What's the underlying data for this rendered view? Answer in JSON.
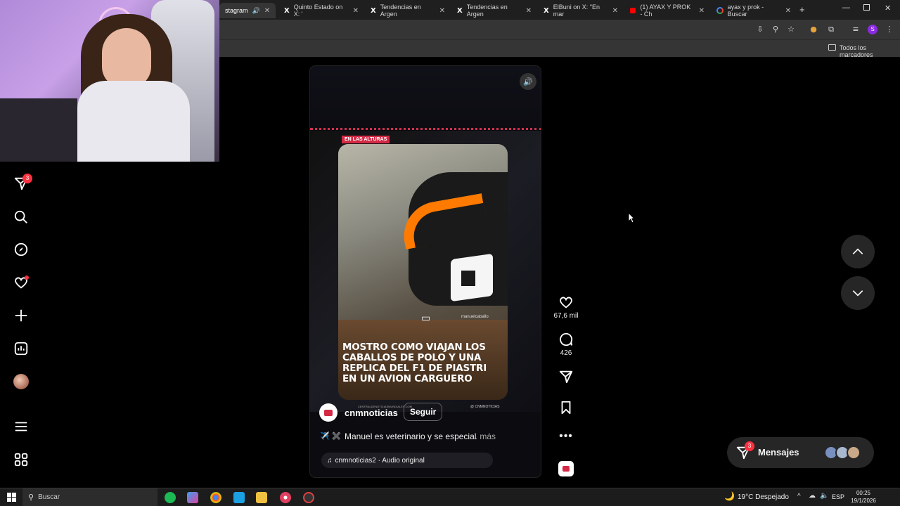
{
  "browser": {
    "tabs": [
      {
        "label": "stagram",
        "favicon": "instagram",
        "active": true
      },
      {
        "label": "Quinto Estado on X: '",
        "favicon": "x"
      },
      {
        "label": "Tendencias en Argen",
        "favicon": "x"
      },
      {
        "label": "Tendencias en Argen",
        "favicon": "x"
      },
      {
        "label": "ElBuni on X: \"En mar",
        "favicon": "x"
      },
      {
        "label": "(1) AYAX Y PROK - Ch",
        "favicon": "youtube"
      },
      {
        "label": "ayax y prok - Buscar",
        "favicon": "google"
      }
    ],
    "bookmarks_label": "Todos los marcadores",
    "profile_initial": "S"
  },
  "sidebar": {
    "notifications_badge": "3"
  },
  "reel": {
    "banner": "EN LAS ALTURAS",
    "caption_overlay": [
      "MOSTRO COMO VIAJAN LOS",
      "CABALLOS DE POLO Y UNA",
      "REPLICA DEL F1 DE PIASTRI",
      "EN UN AVION CARGUERO"
    ],
    "watermark": "manuelcaballo",
    "credit_right": "@ CNMNOTICIAS",
    "credit_left": "CENTRALDENOTICIASMUNDIALES.COM",
    "username": "cnmnoticias",
    "follow_label": "Seguir",
    "caption_emojis": "✈️ ✖️",
    "caption": "Manuel es veterinario y se especial",
    "more_label": "... más",
    "audio": "cnmnoticias2 · Audio original"
  },
  "actions": {
    "likes": "67,6 mil",
    "comments": "426"
  },
  "messages": {
    "label": "Mensajes",
    "badge": "3"
  },
  "taskbar": {
    "search_placeholder": "Buscar",
    "weather": "19°C  Despejado",
    "language": "ESP",
    "time": "00:25",
    "date": "19/1/2026"
  },
  "colors": {
    "accent_red": "#ff3040",
    "instagram_bg": "#000000"
  }
}
